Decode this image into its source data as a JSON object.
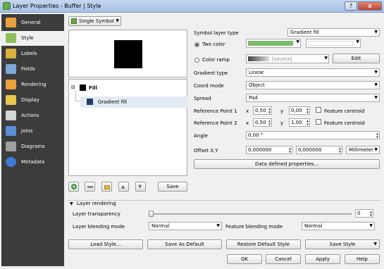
{
  "window": {
    "title": "Layer Properties - Buffer | Style",
    "help_label": "?",
    "close_label": "x"
  },
  "sidebar": {
    "items": [
      {
        "label": "General",
        "icon": "general-icon",
        "color": "#e8a23c"
      },
      {
        "label": "Style",
        "icon": "style-icon",
        "color": "#8fbf5a"
      },
      {
        "label": "Labels",
        "icon": "labels-icon",
        "color": "#d9b13b"
      },
      {
        "label": "Fields",
        "icon": "fields-icon",
        "color": "#7fa7d8"
      },
      {
        "label": "Rendering",
        "icon": "rendering-icon",
        "color": "#e8a23c"
      },
      {
        "label": "Display",
        "icon": "display-icon",
        "color": "#e6c94a"
      },
      {
        "label": "Actions",
        "icon": "actions-icon",
        "color": "#d6d6d6"
      },
      {
        "label": "Joins",
        "icon": "joins-icon",
        "color": "#5b8fd6"
      },
      {
        "label": "Diagrams",
        "icon": "diagrams-icon",
        "color": "#a0a0a0"
      },
      {
        "label": "Metadata",
        "icon": "metadata-icon",
        "color": "#3d7bd6"
      }
    ]
  },
  "renderer": {
    "selected": "Single Symbol"
  },
  "tree": {
    "root": "Fill",
    "child": "Gradient fill"
  },
  "toolbar": {
    "save_label": "Save"
  },
  "symbol": {
    "layer_type_label": "Symbol layer type",
    "layer_type_value": "Gradient fill",
    "two_color_label": "Two color",
    "color_ramp_label": "Color ramp",
    "ramp_source": "[source]",
    "edit_label": "Edit",
    "color1": "#7cba6a",
    "color2": "#ffffff",
    "gradient_type_label": "Gradient type",
    "gradient_type_value": "Linear",
    "coord_mode_label": "Coord mode",
    "coord_mode_value": "Object",
    "spread_label": "Spread",
    "spread_value": "Pad",
    "ref1_label": "Reference Point 1",
    "ref2_label": "Reference Point 2",
    "x_label": "x",
    "y_label": "y",
    "ref1_x": "0,50",
    "ref1_y": "0,00",
    "ref2_x": "0,50",
    "ref2_y": "1,00",
    "feature_centroid": "Feature centroid",
    "angle_label": "Angle",
    "angle_value": "0,00 °",
    "offset_label": "Offset X,Y",
    "offset_x": "0,000000",
    "offset_y": "0,000000",
    "offset_unit": "Millimeter",
    "data_defined_label": "Data defined properties..."
  },
  "layer_rendering": {
    "header": "Layer rendering",
    "transparency_label": "Layer transparency",
    "transparency_value": "0",
    "blending_label": "Layer blending mode",
    "blending_value": "Normal",
    "feature_blending_label": "Feature blending mode",
    "feature_blending_value": "Normal"
  },
  "bottom": {
    "load_style": "Load Style...",
    "save_default": "Save As Default",
    "restore_default": "Restore Default Style",
    "save_style": "Save Style",
    "ok": "OK",
    "cancel": "Cancel",
    "apply": "Apply",
    "help": "Help"
  }
}
